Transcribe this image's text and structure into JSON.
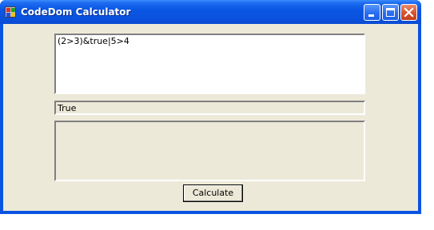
{
  "window": {
    "title": "CodeDom Calculator",
    "icon": "app-icon",
    "controls": {
      "minimize": "minimize-icon",
      "maximize": "maximize-icon",
      "close": "close-icon"
    },
    "colors": {
      "titlebar": "#0a54e3",
      "client_bg": "#ece9d8",
      "close_button": "#d9512c"
    }
  },
  "form": {
    "expression_value": "(2>3)&true|5>4",
    "result_value": "True",
    "error_value": "",
    "calculate_label": "Calculate"
  }
}
